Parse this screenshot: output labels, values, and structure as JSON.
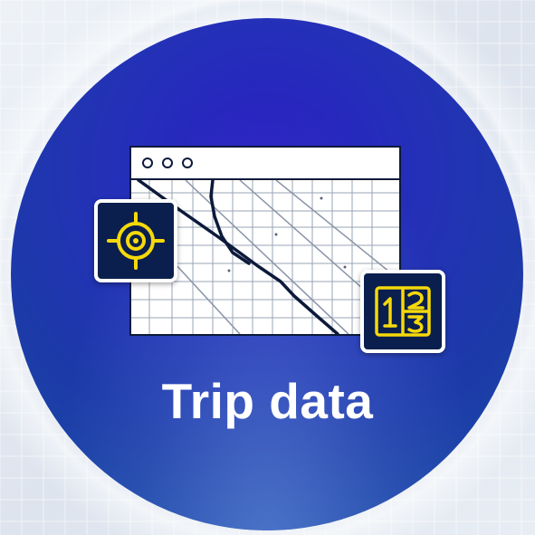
{
  "title": "Trip data",
  "icons": {
    "window": "browser-window-icon",
    "map": "street-map-icon",
    "location_badge": "location-target-icon",
    "numbers_badge": "numbers-one-two-three-icon"
  },
  "colors": {
    "disc_primary": "#2a1ec4",
    "disc_secondary": "#1c3aa8",
    "badge_background": "#0a1f4d",
    "badge_accent": "#f5d90a",
    "title_text": "#ffffff",
    "outline": "#0c1a3a"
  }
}
